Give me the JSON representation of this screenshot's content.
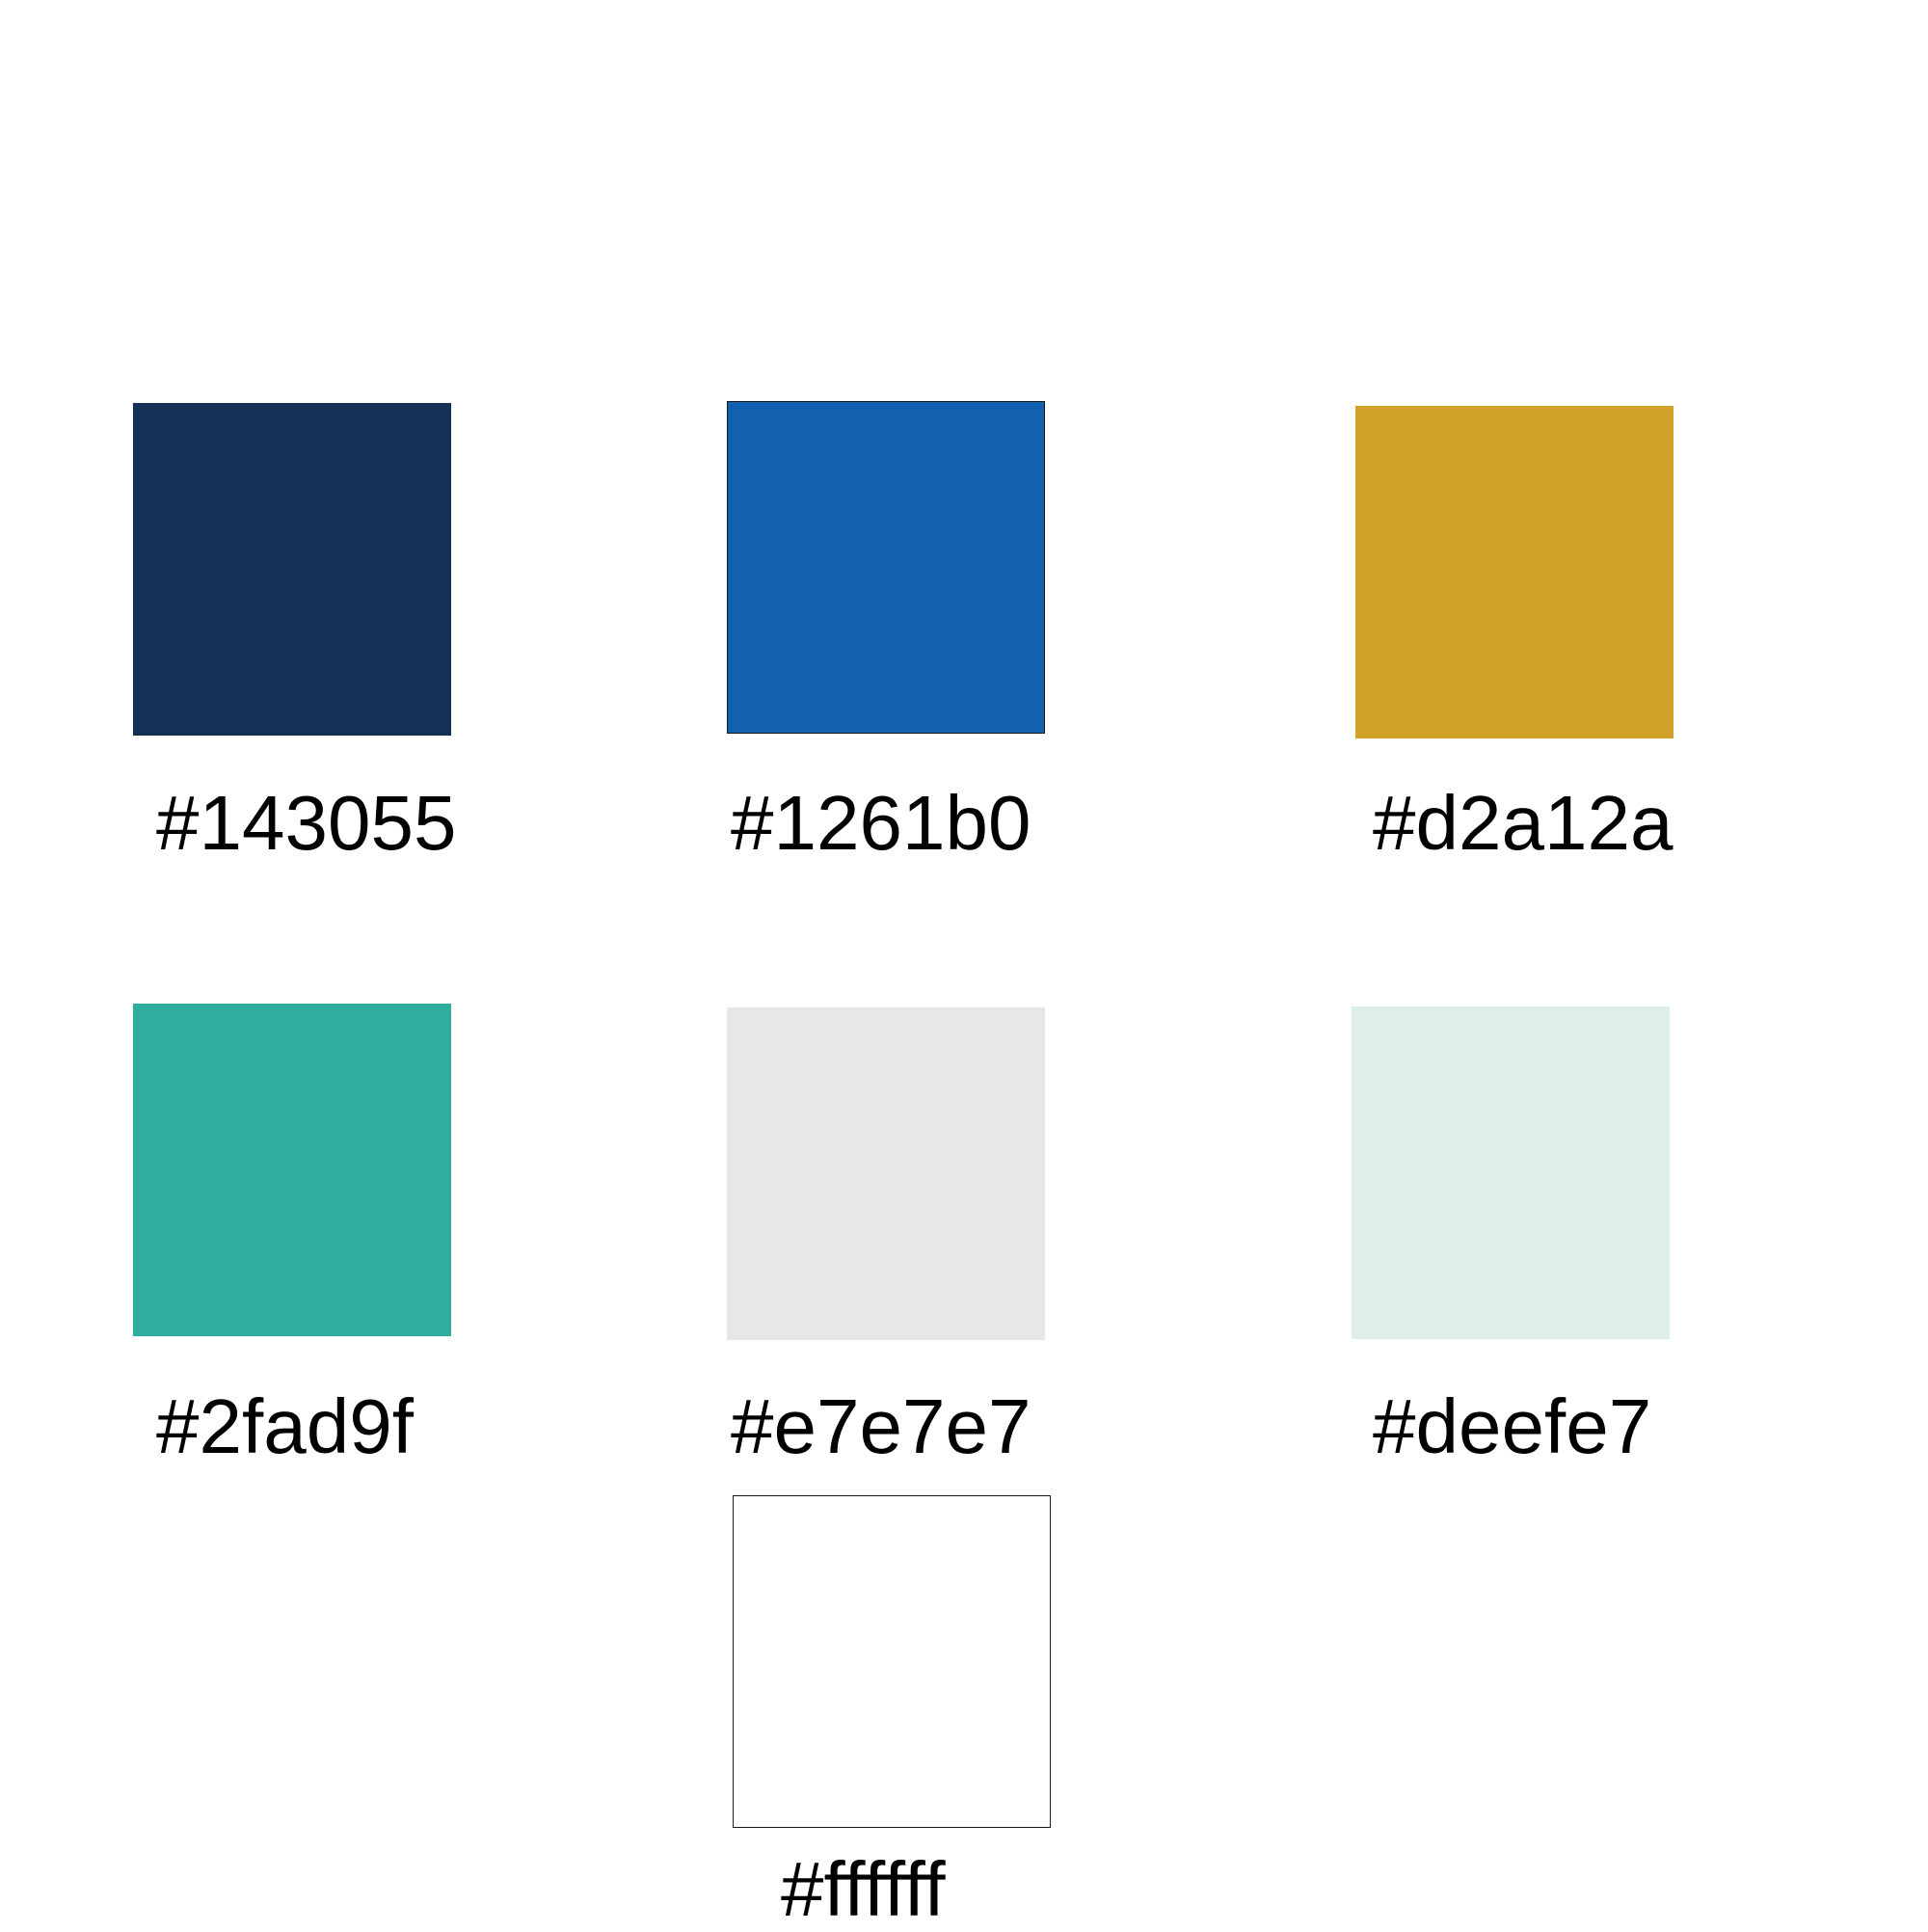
{
  "palette": {
    "swatches": [
      {
        "label": "#143055",
        "color": "#143055",
        "bordered": false
      },
      {
        "label": "#1261b0",
        "color": "#1261b0",
        "bordered": true
      },
      {
        "label": "#d2a12a",
        "color": "#d2a12a",
        "bordered": false
      },
      {
        "label": "#2fad9f",
        "color": "#2fad9f",
        "bordered": false
      },
      {
        "label": "#e7e7e7",
        "color": "#e7e7e7",
        "bordered": false
      },
      {
        "label": "#deefe7",
        "color": "#deefe7",
        "bordered": false
      },
      {
        "label": "#ffffff",
        "color": "#ffffff",
        "bordered": true
      }
    ]
  }
}
